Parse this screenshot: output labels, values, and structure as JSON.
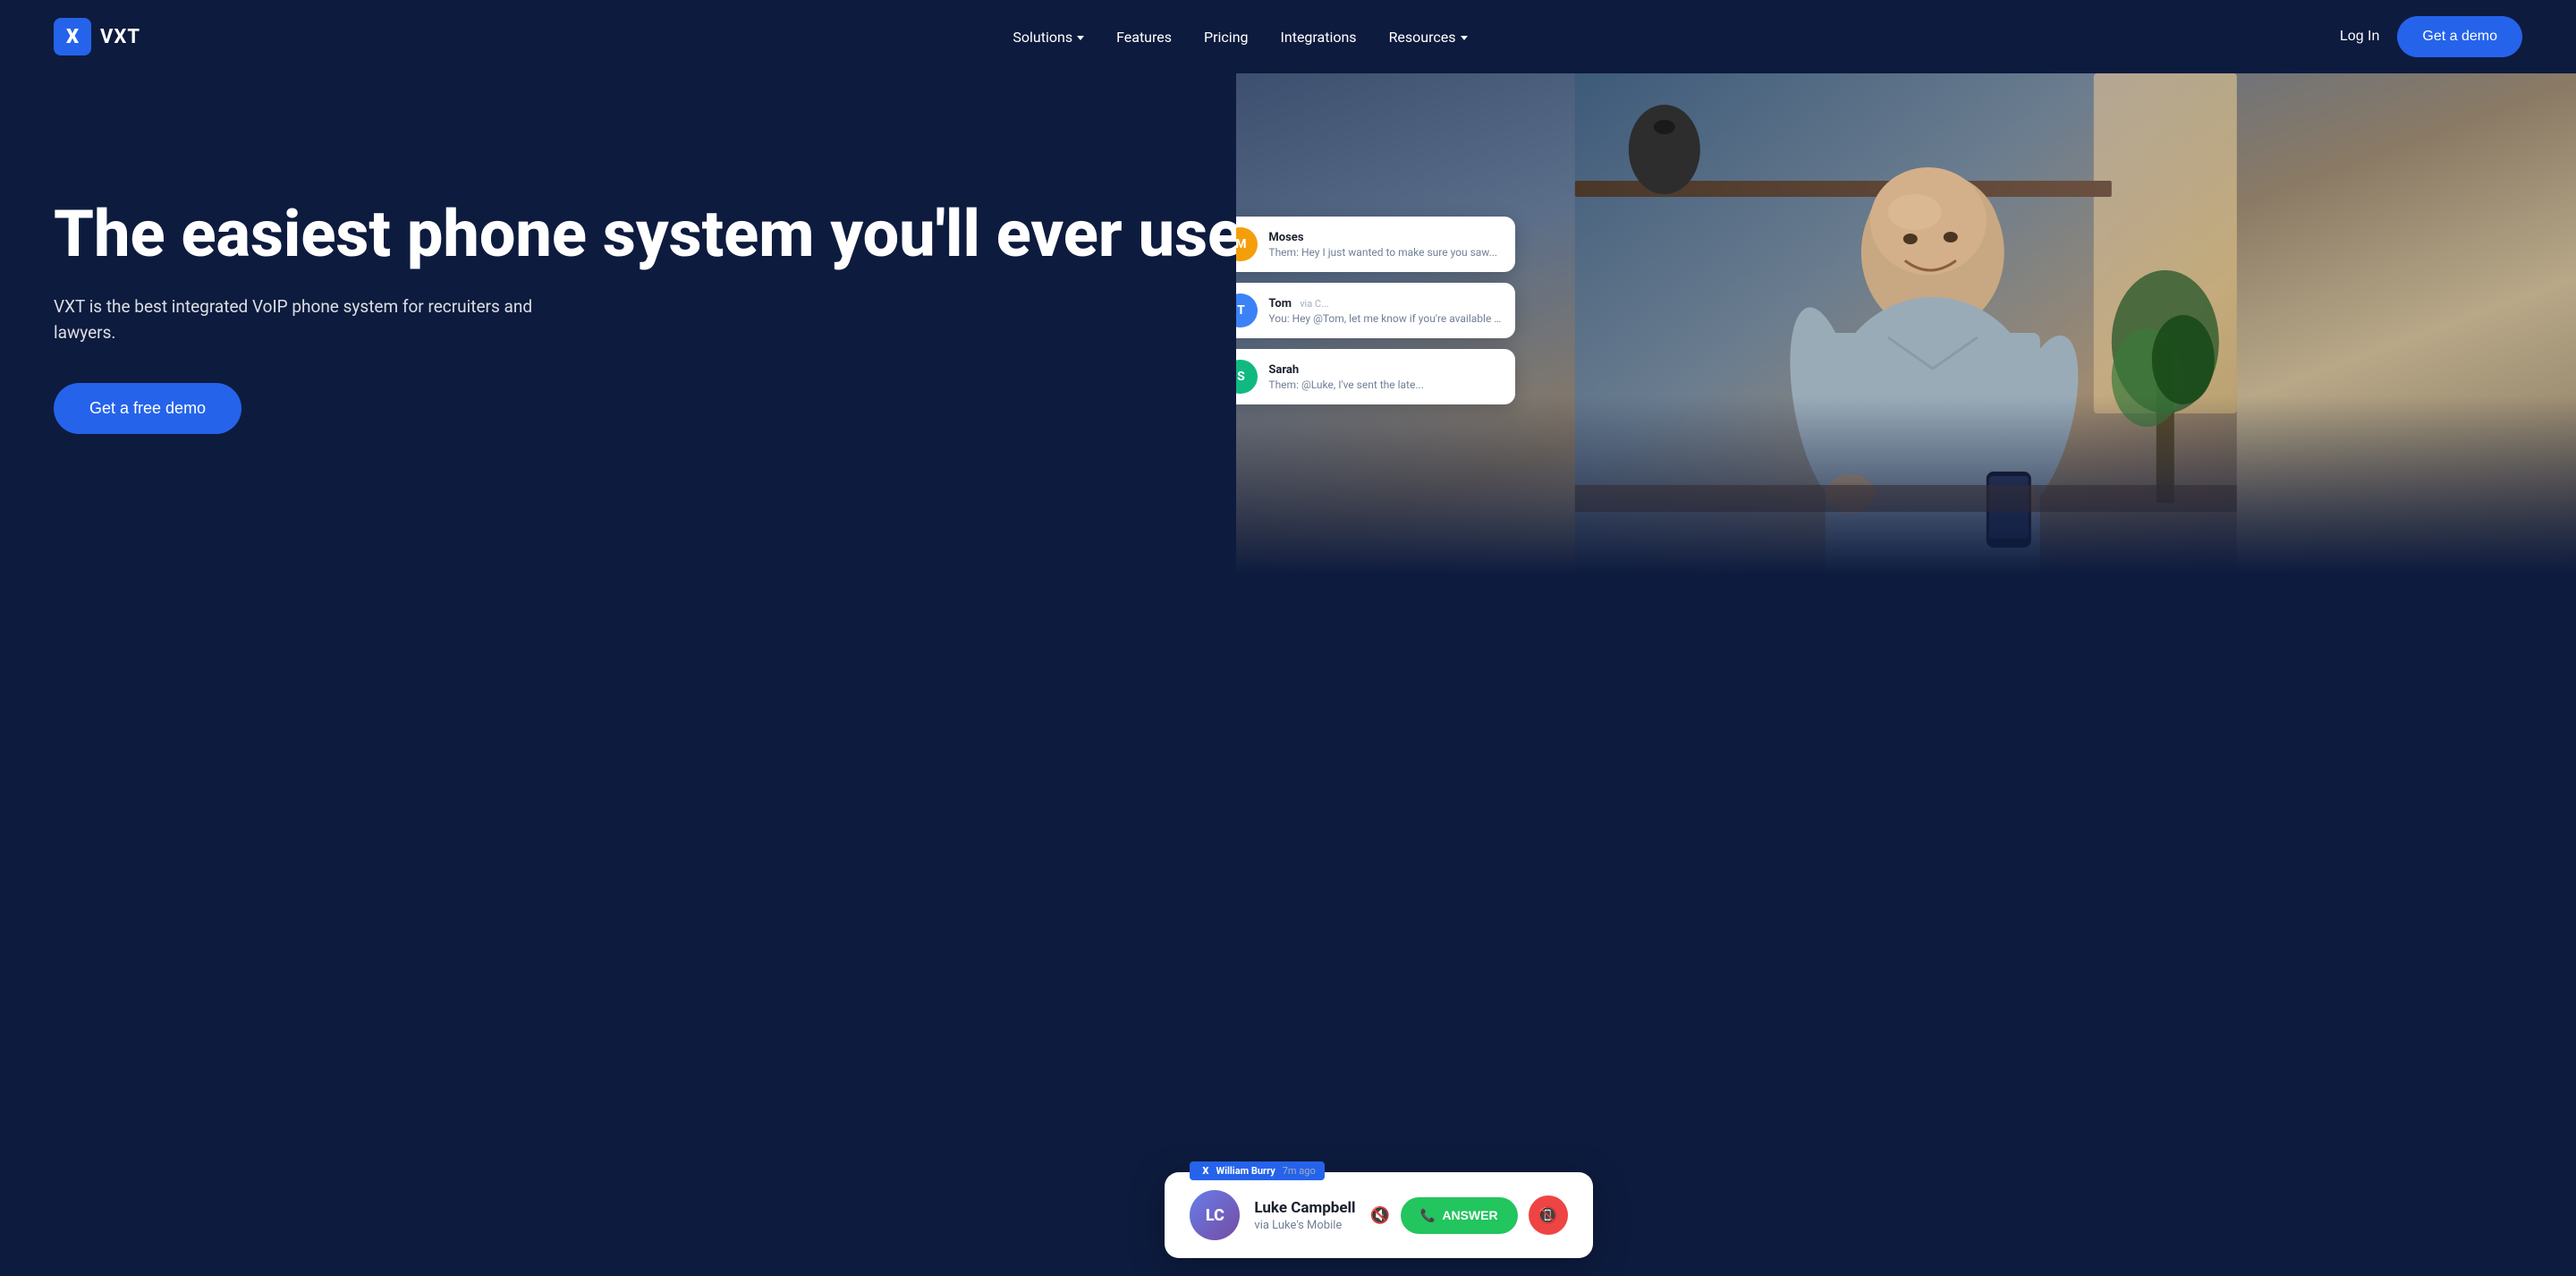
{
  "brand": {
    "logo_letter": "X",
    "name": "VXT"
  },
  "nav": {
    "links": [
      {
        "label": "Solutions",
        "has_dropdown": true
      },
      {
        "label": "Features",
        "has_dropdown": false
      },
      {
        "label": "Pricing",
        "has_dropdown": false
      },
      {
        "label": "Integrations",
        "has_dropdown": false
      },
      {
        "label": "Resources",
        "has_dropdown": true
      }
    ],
    "login_label": "Log In",
    "demo_label": "Get a demo"
  },
  "hero": {
    "title": "The easiest phone system you'll ever use",
    "subtitle": "VXT is the best integrated VoIP phone system for recruiters and lawyers.",
    "cta_label": "Get a free demo"
  },
  "chat_cards": [
    {
      "name": "Moses",
      "avatar_initials": "M",
      "avatar_color": "#f59e0b",
      "message": "Them: Hey I just wanted to make sure you saw...",
      "time": ""
    },
    {
      "name": "Tom",
      "avatar_initials": "T",
      "avatar_color": "#3b82f6",
      "message": "You: Hey @Tom, let me know if you're available f...",
      "time": "via C..."
    },
    {
      "name": "Sarah",
      "avatar_initials": "S",
      "avatar_color": "#10b981",
      "message": "Them: @Luke, I've sent the late...",
      "time": ""
    }
  ],
  "call_card": {
    "caller_initials": "LC",
    "caller_name": "Luke Campbell",
    "via_label": "via Luke's Mobile",
    "answer_label": "ANSWER",
    "vxt_badge": "X",
    "vxt_name": "William Burry",
    "vxt_time": "7m ago"
  },
  "colors": {
    "background": "#0d1b3e",
    "accent_blue": "#2563eb",
    "answer_green": "#22c55e",
    "decline_red": "#ef4444"
  }
}
